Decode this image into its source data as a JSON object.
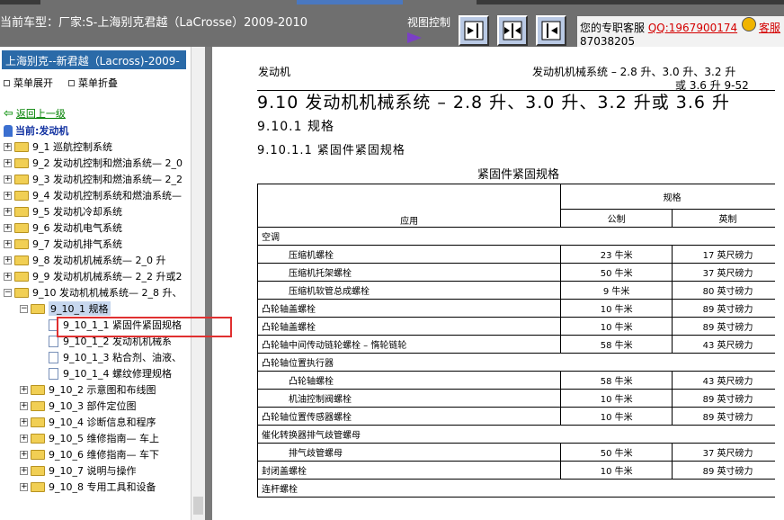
{
  "topbar": {
    "car_title": "当前车型：厂家:S-上海别克君越（LaCrosse）2009-2010",
    "view_control": "视图控制",
    "support_line1": "您的专职客服",
    "support_qq": "QQ:1967900174",
    "support_service": "客服",
    "support_line2": "87038205"
  },
  "sidebar": {
    "header": "上海别克--新君越（Lacross)-2009-",
    "expand": "菜单展开",
    "collapse": "菜单折叠",
    "back": "返回上一级",
    "current": "当前:发动机",
    "nodes": [
      {
        "label": "9_1 巡航控制系统"
      },
      {
        "label": "9_2 发动机控制和燃油系统— 2_0"
      },
      {
        "label": "9_3 发动机控制和燃油系统— 2_2"
      },
      {
        "label": "9_4 发动机控制系统和燃油系统—"
      },
      {
        "label": "9_5 发动机冷却系统"
      },
      {
        "label": "9_6 发动机电气系统"
      },
      {
        "label": "9_7 发动机排气系统"
      },
      {
        "label": "9_8 发动机机械系统— 2_0 升"
      },
      {
        "label": "9_9 发动机机械系统— 2_2 升或2"
      },
      {
        "label": "9_10 发动机机械系统— 2_8 升、"
      },
      {
        "label": "9_10_1 规格"
      },
      {
        "label": "9_10_1_1 紧固件紧固规格"
      },
      {
        "label": "9_10_1_2 发动机机械系"
      },
      {
        "label": "9_10_1_3 粘合剂、油液、"
      },
      {
        "label": "9_10_1_4 螺纹修理规格"
      },
      {
        "label": "9_10_2 示意图和布线图"
      },
      {
        "label": "9_10_3 部件定位图"
      },
      {
        "label": "9_10_4 诊断信息和程序"
      },
      {
        "label": "9_10_5 维修指南— 车上"
      },
      {
        "label": "9_10_6 维修指南— 车下"
      },
      {
        "label": "9_10_7 说明与操作"
      },
      {
        "label": "9_10_8 专用工具和设备"
      }
    ]
  },
  "content": {
    "header_left": "发动机",
    "header_right_1": "发动机机械系统 – 2.8 升、3.0 升、3.2 升",
    "header_right_2": "或 3.6 升   9-52",
    "title": "9.10 发动机机械系统 – 2.8 升、3.0 升、3.2 升或 3.6 升",
    "subtitle": "9.10.1 规格",
    "subsubtitle": "9.10.1.1 紧固件紧固规格",
    "table_caption": "紧固件紧固规格",
    "table": {
      "col_application": "应用",
      "col_spec": "规格",
      "col_metric": "公制",
      "col_english": "英制",
      "rows": [
        {
          "app": "空调",
          "metric": "",
          "english": "",
          "indent": false,
          "group": true
        },
        {
          "app": "压缩机螺栓",
          "metric": "23 牛米",
          "english": "17 英尺磅力",
          "indent": true
        },
        {
          "app": "压缩机托架螺栓",
          "metric": "50 牛米",
          "english": "37 英尺磅力",
          "indent": true
        },
        {
          "app": "压缩机软管总成螺栓",
          "metric": "9 牛米",
          "english": "80 英寸磅力",
          "indent": true
        },
        {
          "app": "凸轮轴盖螺栓",
          "metric": "10 牛米",
          "english": "89 英寸磅力",
          "indent": false
        },
        {
          "app": "凸轮轴盖螺栓",
          "metric": "10 牛米",
          "english": "89 英寸磅力",
          "indent": false
        },
        {
          "app": "凸轮轴中间传动链轮螺栓 – 惰轮链轮",
          "metric": "58 牛米",
          "english": "43 英尺磅力",
          "indent": false
        },
        {
          "app": "凸轮轴位置执行器",
          "metric": "",
          "english": "",
          "indent": false,
          "group": true
        },
        {
          "app": "凸轮轴螺栓",
          "metric": "58 牛米",
          "english": "43 英尺磅力",
          "indent": true
        },
        {
          "app": "机油控制阀螺栓",
          "metric": "10 牛米",
          "english": "89 英寸磅力",
          "indent": true
        },
        {
          "app": "凸轮轴位置传感器螺栓",
          "metric": "10 牛米",
          "english": "89 英寸磅力",
          "indent": false
        },
        {
          "app": "催化转换器排气歧管螺母",
          "metric": "",
          "english": "",
          "indent": false,
          "group": true
        },
        {
          "app": "排气歧管螺母",
          "metric": "50 牛米",
          "english": "37 英尺磅力",
          "indent": true
        },
        {
          "app": "封闭盖螺栓",
          "metric": "10 牛米",
          "english": "89 英寸磅力",
          "indent": false
        },
        {
          "app": "连杆螺栓",
          "metric": "",
          "english": "",
          "indent": false,
          "group": true
        }
      ]
    }
  }
}
